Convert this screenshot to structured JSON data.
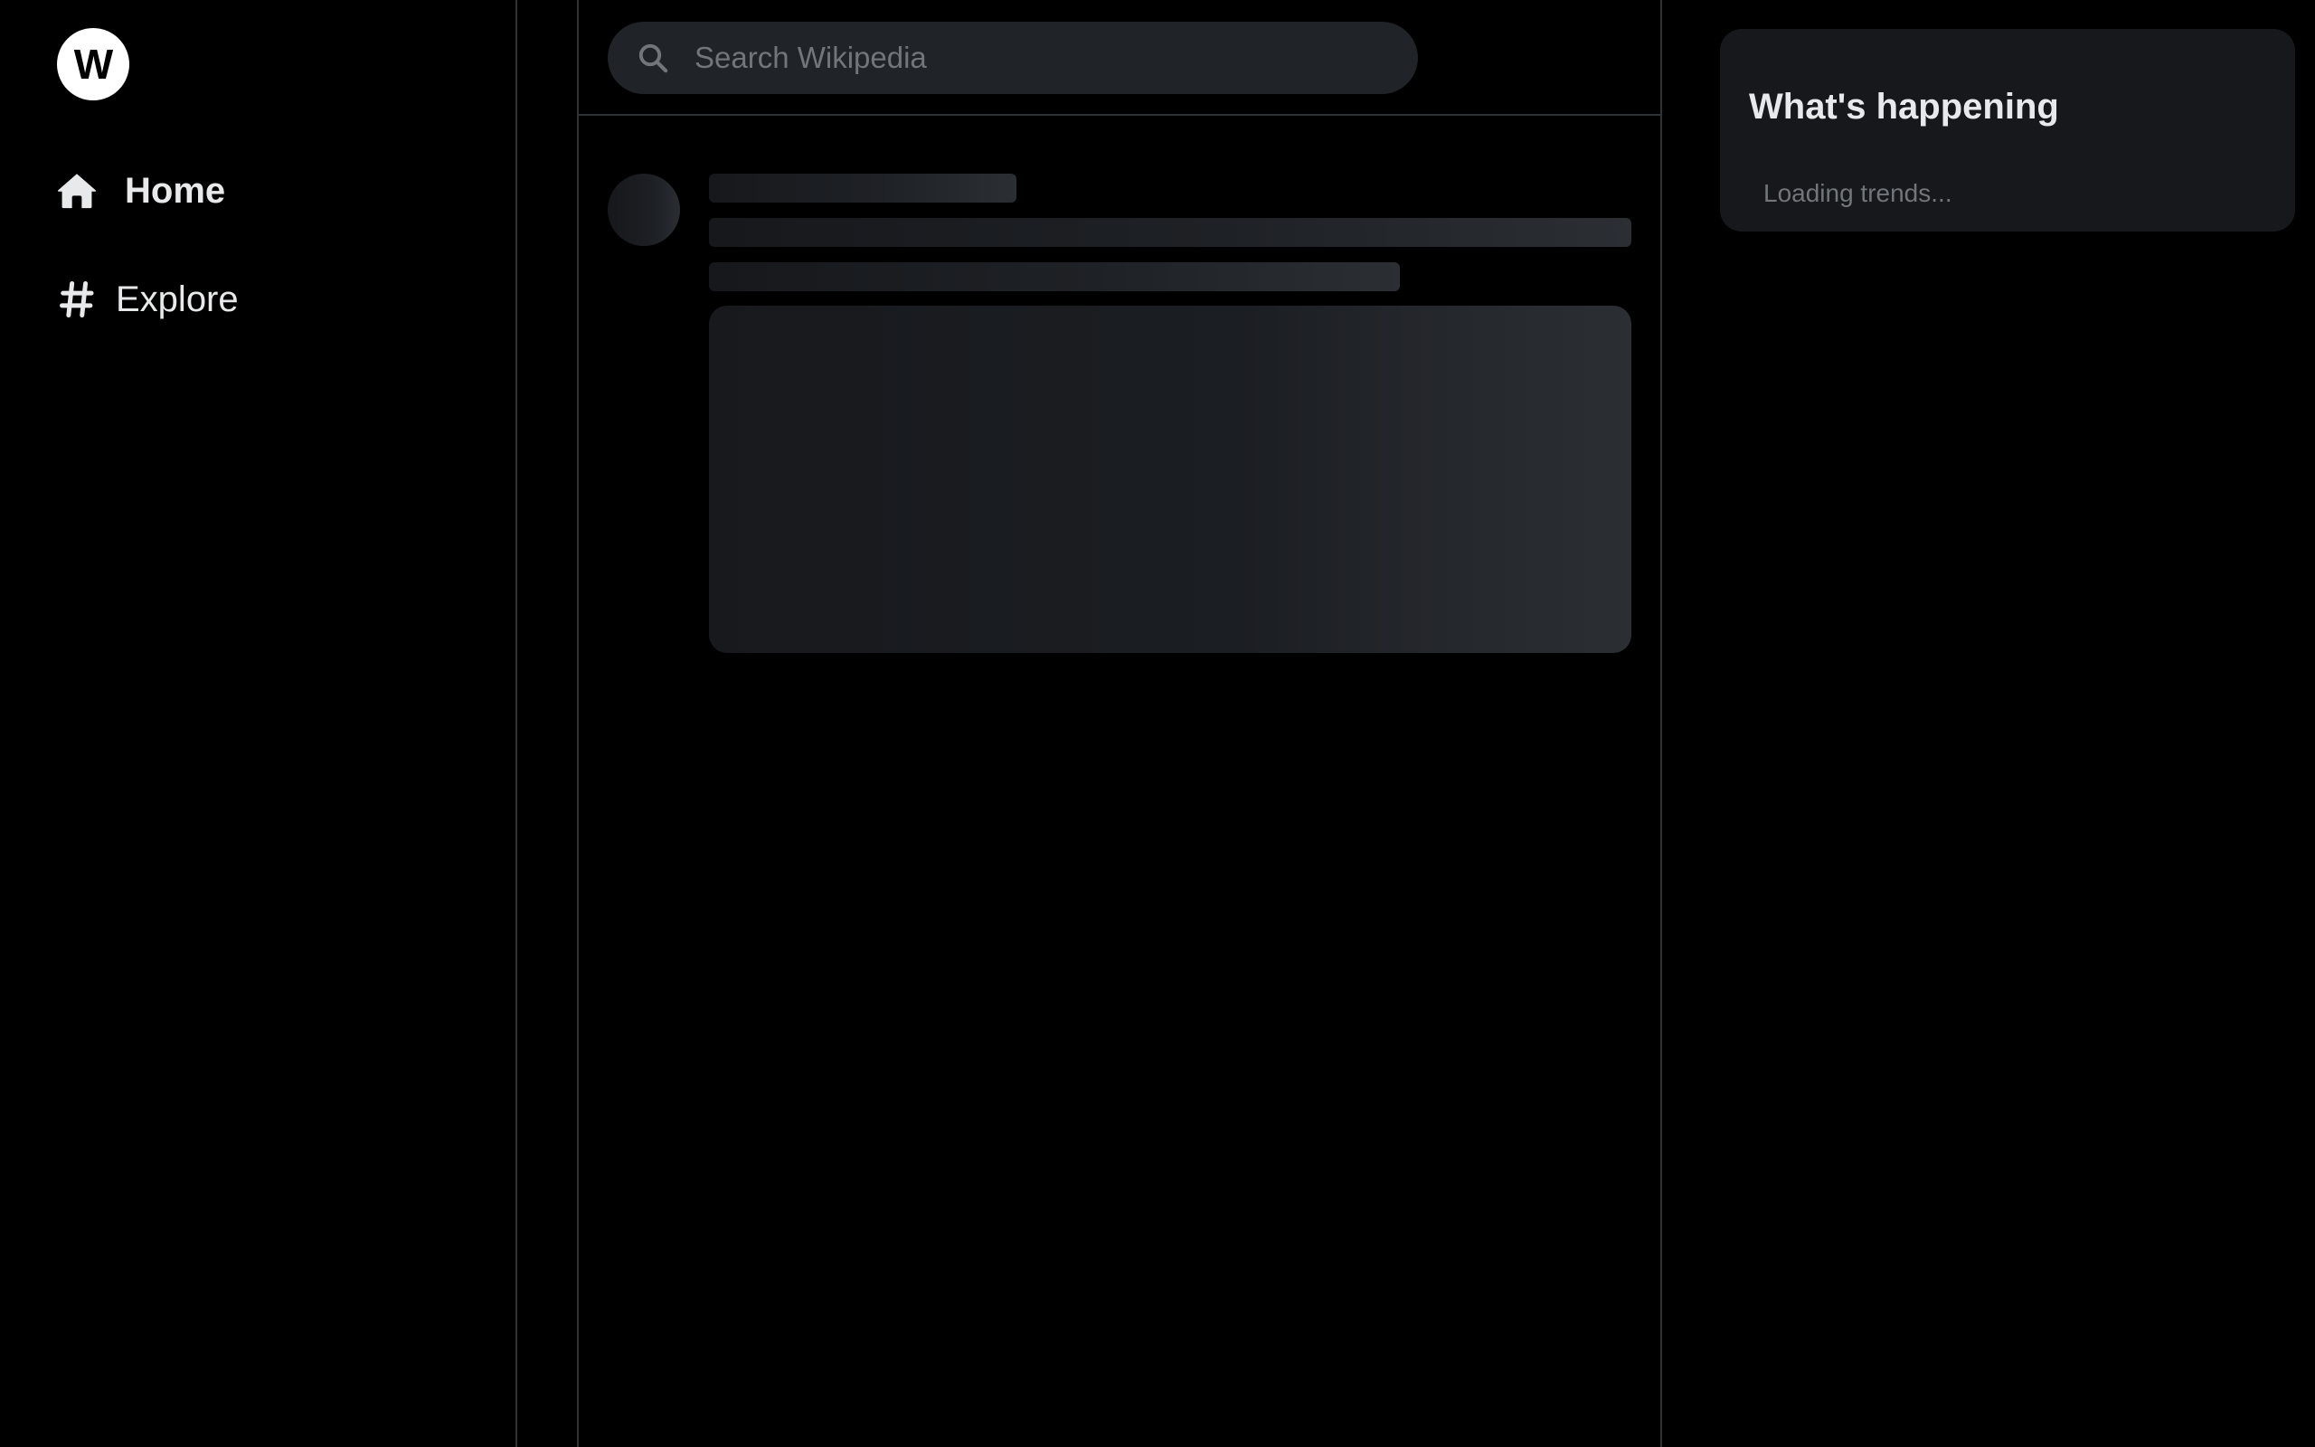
{
  "sidebar": {
    "logo": {
      "text": "W",
      "icon": "wikipedia-logo"
    },
    "items": [
      {
        "label": "Home",
        "icon": "home-icon",
        "active": true
      },
      {
        "label": "Explore",
        "icon": "hashtag-icon",
        "active": false
      }
    ]
  },
  "search": {
    "placeholder": "Search Wikipedia",
    "value": "",
    "icon": "search-icon"
  },
  "feed": {
    "state": "loading",
    "skeleton_posts": 1
  },
  "trends": {
    "title": "What's happening",
    "status": "Loading trends..."
  },
  "colors": {
    "background": "#000000",
    "border": "#2f3336",
    "card": "#16181c",
    "search_bg": "#202327",
    "text_primary": "#e7e9ea",
    "text_secondary": "#71767b"
  }
}
